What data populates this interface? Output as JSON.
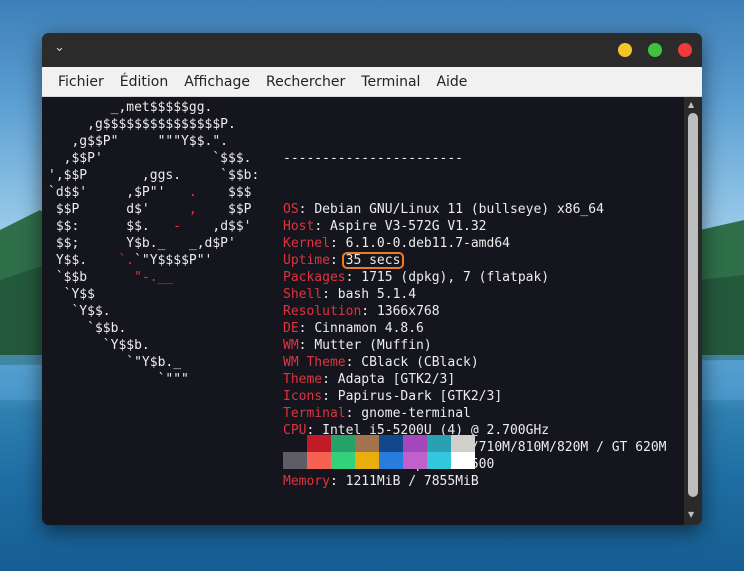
{
  "window": {
    "chevron_glyph": "⌄"
  },
  "menu": [
    "Fichier",
    "Édition",
    "Affichage",
    "Rechercher",
    "Terminal",
    "Aide"
  ],
  "logo_lines": [
    [
      {
        "t": "        _,met$$$$$gg."
      }
    ],
    [
      {
        "t": "     ,g$$$$$$$$$$$$$$$P."
      }
    ],
    [
      {
        "t": "   ,g$$P\"     \"\"\"Y$$.\"."
      }
    ],
    [
      {
        "t": "  ,$$P'              `$$$."
      }
    ],
    [
      {
        "t": "',$$P       ,ggs.     `$$b:"
      }
    ],
    [
      {
        "t": "`d$$'     ,$P\"'   "
      },
      {
        "t": ".",
        "r": true
      },
      {
        "t": "    $$$"
      }
    ],
    [
      {
        "t": " $$P      d$'     "
      },
      {
        "t": ",",
        "r": true
      },
      {
        "t": "    $$P"
      }
    ],
    [
      {
        "t": " $$:      $$.   "
      },
      {
        "t": "-",
        "r": true
      },
      {
        "t": "    ,d$$'"
      }
    ],
    [
      {
        "t": " $$;      Y$b._   _,d$P'"
      }
    ],
    [
      {
        "t": " Y$$.    "
      },
      {
        "t": "`.",
        "r": true
      },
      {
        "t": "`\"Y$$$$P\"'"
      }
    ],
    [
      {
        "t": " `$$b      "
      },
      {
        "t": "\"-.__",
        "r": true
      }
    ],
    [
      {
        "t": "  `Y$$"
      }
    ],
    [
      {
        "t": "   `Y$$."
      }
    ],
    [
      {
        "t": "     `$$b."
      }
    ],
    [
      {
        "t": "       `Y$$b."
      }
    ],
    [
      {
        "t": "          `\"Y$b._"
      }
    ],
    [
      {
        "t": "              `\"\"\""
      }
    ]
  ],
  "info": {
    "separator": "-----------------------",
    "rows": [
      {
        "key": "OS",
        "value": "Debian GNU/Linux 11 (bullseye) x86_64"
      },
      {
        "key": "Host",
        "value": "Aspire V3-572G V1.32"
      },
      {
        "key": "Kernel",
        "value": "6.1.0-0.deb11.7-amd64"
      },
      {
        "key": "Uptime",
        "value": "35 secs",
        "highlight": true
      },
      {
        "key": "Packages",
        "value": "1715 (dpkg), 7 (flatpak)"
      },
      {
        "key": "Shell",
        "value": "bash 5.1.4"
      },
      {
        "key": "Resolution",
        "value": "1366x768"
      },
      {
        "key": "DE",
        "value": "Cinnamon 4.8.6"
      },
      {
        "key": "WM",
        "value": "Mutter (Muffin)"
      },
      {
        "key": "WM Theme",
        "value": "CBlack (CBlack)"
      },
      {
        "key": "Theme",
        "value": "Adapta [GTK2/3]"
      },
      {
        "key": "Icons",
        "value": "Papirus-Dark [GTK2/3]"
      },
      {
        "key": "Terminal",
        "value": "gnome-terminal"
      },
      {
        "key": "CPU",
        "value": "Intel i5-5200U (4) @ 2.700GHz"
      },
      {
        "key": "GPU",
        "value": "NVIDIA GeForce 610M/710M/810M/820M / GT 620M"
      },
      {
        "key": "GPU",
        "value": "Intel HD Graphics 5500"
      },
      {
        "key": "Memory",
        "value": "1211MiB / 7855MiB"
      }
    ]
  },
  "palette": {
    "row1": [
      "#15161d",
      "#c01c28",
      "#26a269",
      "#a2734c",
      "#12488b",
      "#a347ba",
      "#2aa1b3",
      "#d0cfcc"
    ],
    "row2": [
      "#5e5c64",
      "#f66151",
      "#33d17a",
      "#e9ad0c",
      "#2a7bde",
      "#c061cb",
      "#33c7de",
      "#ffffff"
    ]
  },
  "colors": {
    "key_red": "#e0323f",
    "highlight_orange": "#f07a1e"
  }
}
